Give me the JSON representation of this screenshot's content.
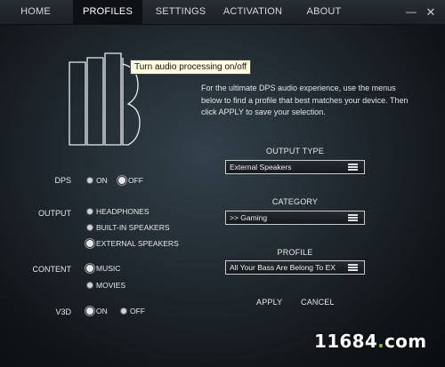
{
  "nav": {
    "tabs": [
      {
        "label": "HOME"
      },
      {
        "label": "PROFILES"
      },
      {
        "label": "SETTINGS"
      },
      {
        "label": "ACTIVATION"
      },
      {
        "label": "ABOUT"
      }
    ],
    "minimize": "—",
    "close": "✕"
  },
  "tooltip": "Turn audio processing on/off",
  "intro": "For the ultimate DPS audio experience, use the menus below to find a profile that best matches your device. Then click APPLY to save your selection.",
  "options": {
    "dps": {
      "label": "DPS",
      "on": "ON",
      "off": "OFF",
      "selected": "OFF"
    },
    "output": {
      "label": "OUTPUT",
      "choices": [
        "HEADPHONES",
        "BUILT-IN SPEAKERS",
        "EXTERNAL SPEAKERS"
      ],
      "selected": "EXTERNAL SPEAKERS"
    },
    "content": {
      "label": "CONTENT",
      "choices": [
        "MUSIC",
        "MOVIES"
      ],
      "selected": "MUSIC"
    },
    "v3d": {
      "label": "V3D",
      "on": "ON",
      "off": "OFF",
      "selected": "ON"
    }
  },
  "selectors": {
    "output_type": {
      "title": "OUTPUT TYPE",
      "value": "External Speakers"
    },
    "category": {
      "title": "CATEGORY",
      "value": ">> Gaming"
    },
    "profile": {
      "title": "PROFILE",
      "value": "All Your Bass Are Belong To EX"
    }
  },
  "actions": {
    "apply": "APPLY",
    "cancel": "CANCEL"
  },
  "watermark": {
    "main": "11684",
    "dot": ".",
    "tld": "com"
  }
}
